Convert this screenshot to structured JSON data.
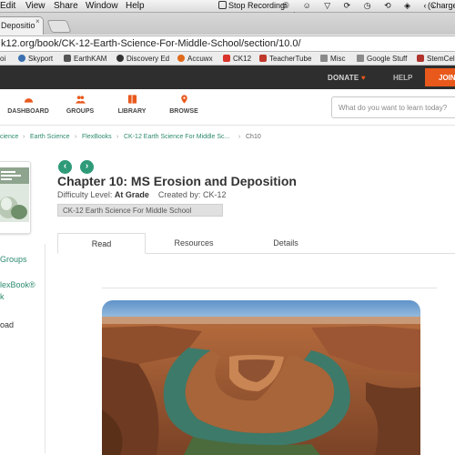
{
  "menubar": {
    "items": [
      "Edit",
      "View",
      "Share",
      "Window",
      "Help"
    ],
    "stop_recording": "Stop Recording",
    "charge": "(Charge"
  },
  "browser_tab": {
    "title": "Depositio",
    "close": "×"
  },
  "address": {
    "url": "k12.org/book/CK-12-Earth-Science-For-Middle-School/section/10.0/"
  },
  "bookmarks": [
    {
      "label": "oi",
      "color": "#888888"
    },
    {
      "label": "Skyport",
      "color": "#3a6fb0"
    },
    {
      "label": "EarthKAM",
      "color": "#555555"
    },
    {
      "label": "Discovery Ed",
      "color": "#333333"
    },
    {
      "label": "Accuwx",
      "color": "#e06a1b"
    },
    {
      "label": "CK12",
      "color": "#d9342b"
    },
    {
      "label": "TeacherTube",
      "color": "#c0392b"
    },
    {
      "label": "Misc",
      "color": "#8a8a8a"
    },
    {
      "label": "Google Stuff",
      "color": "#8a8a8a"
    },
    {
      "label": "StemCell",
      "color": "#b0342e"
    }
  ],
  "topnav": {
    "donate": "DONATE",
    "help": "HELP",
    "join": "JOIN"
  },
  "mainnav": {
    "items": [
      "DASHBOARD",
      "GROUPS",
      "LIBRARY",
      "BROWSE"
    ],
    "search_placeholder": "What do you want to learn today?"
  },
  "breadcrumbs": [
    "cience",
    "Earth Science",
    "FlexBooks",
    "CK-12 Earth Science For Middle Sc...",
    "Ch10"
  ],
  "sidebar": {
    "groups": "Groups",
    "flexbook_1": "lexBook®",
    "flexbook_2": "k",
    "load": "oad"
  },
  "chapter": {
    "title": "Chapter 10: MS Erosion and Deposition",
    "difficulty_label": "Difficulty Level:",
    "difficulty_value": "At Grade",
    "created_label": "Created by:",
    "created_value": "CK-12",
    "book_tag": "CK-12 Earth Science For Middle School"
  },
  "content_tabs": [
    "Read",
    "Resources",
    "Details"
  ],
  "colors": {
    "accent": "#2e9a78",
    "join": "#e9591c",
    "topbar": "#2e2e2e",
    "link": "#2c8a6f"
  }
}
